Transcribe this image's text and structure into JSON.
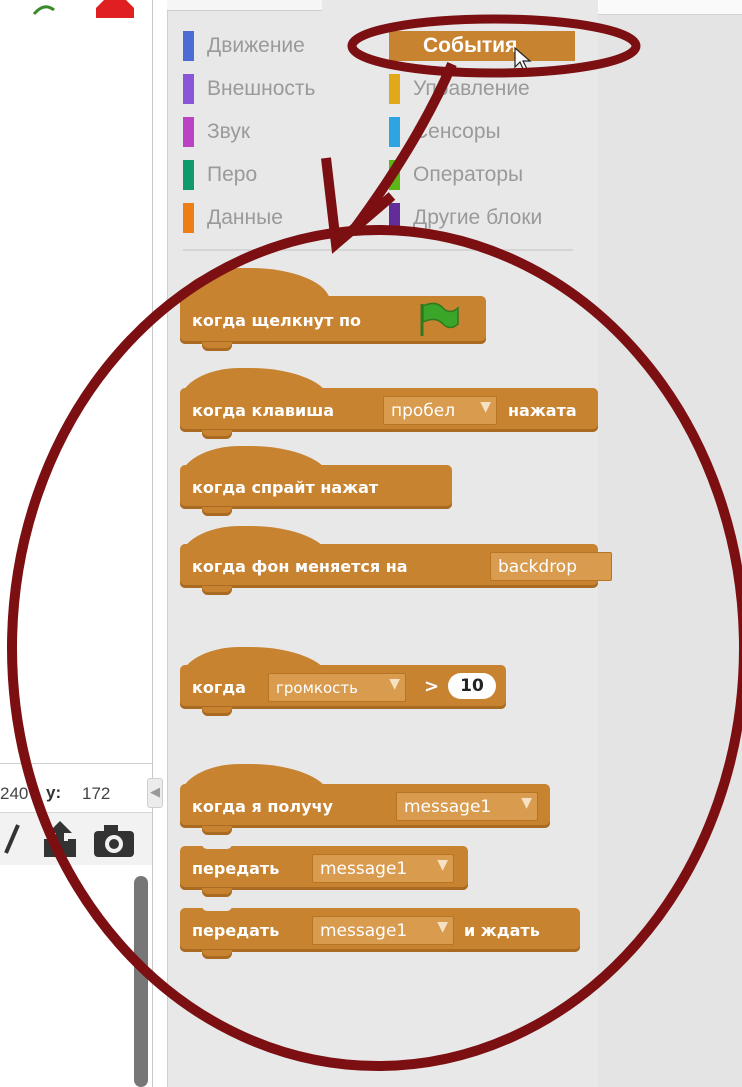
{
  "stage": {
    "x_value": "240",
    "y_label": "y:",
    "y_value": "172"
  },
  "categories_left": [
    {
      "label": "Движение",
      "color": "#4a6cd4"
    },
    {
      "label": "Внешность",
      "color": "#8a55d7"
    },
    {
      "label": "Звук",
      "color": "#bb42c3"
    },
    {
      "label": "Перо",
      "color": "#0e9a6c"
    },
    {
      "label": "Данные",
      "color": "#ee7d16"
    }
  ],
  "categories_right": [
    {
      "label": "События",
      "color": "#c88330",
      "active": true
    },
    {
      "label": "Управление",
      "color": "#e1a91a"
    },
    {
      "label": "Сенсоры",
      "color": "#2ca5e2"
    },
    {
      "label": "Операторы",
      "color": "#5cb712"
    },
    {
      "label": "Другие блоки",
      "color": "#632d99"
    }
  ],
  "blocks": {
    "flag_clicked": "когда щелкнут по",
    "key_pressed": {
      "pre": "когда клавиша",
      "value": "пробел",
      "post": "нажата"
    },
    "sprite_clicked": "когда спрайт нажат",
    "backdrop_switch": {
      "pre": "когда фон меняется на",
      "value": "backdrop"
    },
    "sensor_gt": {
      "pre": "когда",
      "value": "громкость",
      "op": ">",
      "num": "10"
    },
    "receive": {
      "pre": "когда я получу",
      "value": "message1"
    },
    "broadcast": {
      "pre": "передать",
      "value": "message1"
    },
    "broadcast_wait": {
      "pre": "передать",
      "value": "message1",
      "post": "и ждать"
    }
  },
  "colors": {
    "events": "#c88330",
    "annotation": "#7b0f12",
    "flag": "#3ba529"
  }
}
